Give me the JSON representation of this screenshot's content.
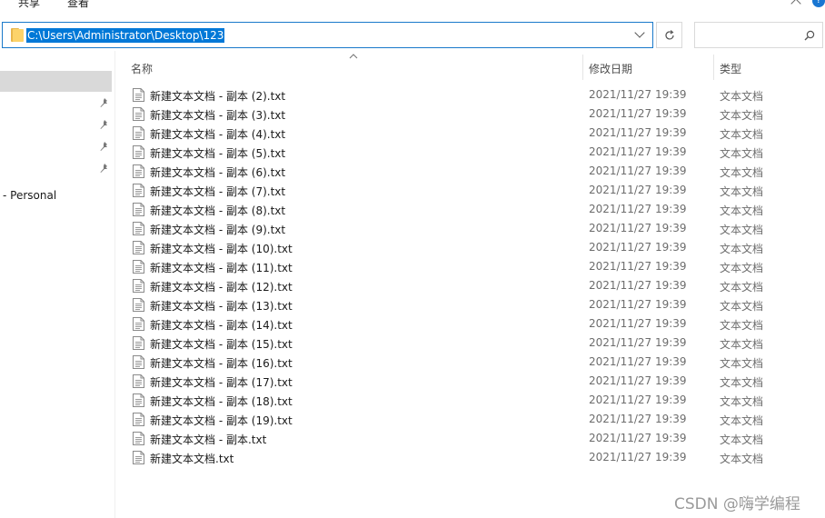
{
  "ribbon": {
    "tabs": [
      "共享",
      "查看"
    ]
  },
  "address_bar": {
    "path": "C:\\Users\\Administrator\\Desktop\\123"
  },
  "search": {
    "placeholder": ""
  },
  "nav": {
    "personal_label": "- Personal",
    "pinned_count": 4
  },
  "columns": {
    "name": "名称",
    "date": "修改日期",
    "type": "类型"
  },
  "files": [
    {
      "name": "新建文本文档 - 副本 (2).txt",
      "date": "2021/11/27 19:39",
      "type": "文本文档"
    },
    {
      "name": "新建文本文档 - 副本 (3).txt",
      "date": "2021/11/27 19:39",
      "type": "文本文档"
    },
    {
      "name": "新建文本文档 - 副本 (4).txt",
      "date": "2021/11/27 19:39",
      "type": "文本文档"
    },
    {
      "name": "新建文本文档 - 副本 (5).txt",
      "date": "2021/11/27 19:39",
      "type": "文本文档"
    },
    {
      "name": "新建文本文档 - 副本 (6).txt",
      "date": "2021/11/27 19:39",
      "type": "文本文档"
    },
    {
      "name": "新建文本文档 - 副本 (7).txt",
      "date": "2021/11/27 19:39",
      "type": "文本文档"
    },
    {
      "name": "新建文本文档 - 副本 (8).txt",
      "date": "2021/11/27 19:39",
      "type": "文本文档"
    },
    {
      "name": "新建文本文档 - 副本 (9).txt",
      "date": "2021/11/27 19:39",
      "type": "文本文档"
    },
    {
      "name": "新建文本文档 - 副本 (10).txt",
      "date": "2021/11/27 19:39",
      "type": "文本文档"
    },
    {
      "name": "新建文本文档 - 副本 (11).txt",
      "date": "2021/11/27 19:39",
      "type": "文本文档"
    },
    {
      "name": "新建文本文档 - 副本 (12).txt",
      "date": "2021/11/27 19:39",
      "type": "文本文档"
    },
    {
      "name": "新建文本文档 - 副本 (13).txt",
      "date": "2021/11/27 19:39",
      "type": "文本文档"
    },
    {
      "name": "新建文本文档 - 副本 (14).txt",
      "date": "2021/11/27 19:39",
      "type": "文本文档"
    },
    {
      "name": "新建文本文档 - 副本 (15).txt",
      "date": "2021/11/27 19:39",
      "type": "文本文档"
    },
    {
      "name": "新建文本文档 - 副本 (16).txt",
      "date": "2021/11/27 19:39",
      "type": "文本文档"
    },
    {
      "name": "新建文本文档 - 副本 (17).txt",
      "date": "2021/11/27 19:39",
      "type": "文本文档"
    },
    {
      "name": "新建文本文档 - 副本 (18).txt",
      "date": "2021/11/27 19:39",
      "type": "文本文档"
    },
    {
      "name": "新建文本文档 - 副本 (19).txt",
      "date": "2021/11/27 19:39",
      "type": "文本文档"
    },
    {
      "name": "新建文本文档 - 副本.txt",
      "date": "2021/11/27 19:39",
      "type": "文本文档"
    },
    {
      "name": "新建文本文档.txt",
      "date": "2021/11/27 19:39",
      "type": "文本文档"
    }
  ],
  "watermark": "CSDN @嗨学编程",
  "colors": {
    "accent": "#0078d7",
    "selection": "#d9d9d9",
    "folder": "#fcd36a"
  }
}
